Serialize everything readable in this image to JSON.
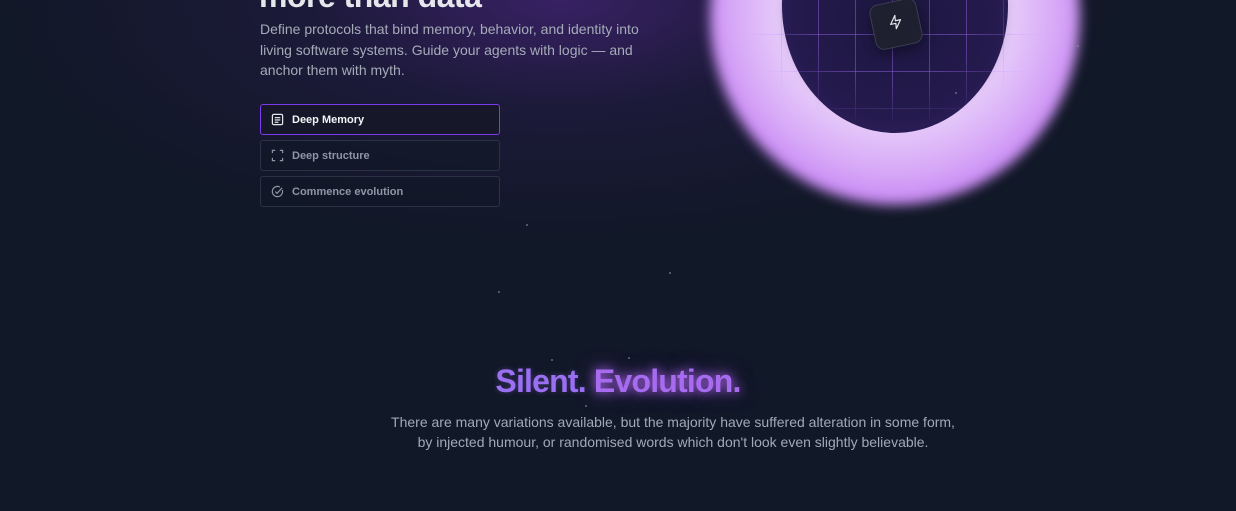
{
  "hero": {
    "title": "more than data",
    "description": "Define protocols that bind memory, behavior, and identity into living software systems. Guide your agents with logic — and anchor them with myth."
  },
  "features": [
    {
      "label": "Deep Memory",
      "icon": "document-icon",
      "active": true
    },
    {
      "label": "Deep structure",
      "icon": "focus-frame-icon",
      "active": false
    },
    {
      "label": "Commence evolution",
      "icon": "circle-check-icon",
      "active": false
    }
  ],
  "visual": {
    "badge_icon": "lightning-bolt-icon",
    "ring_color": "#c084fc",
    "grid_color": "#a76eff"
  },
  "section": {
    "title_part1": "Silent.",
    "title_part2": "Evolution.",
    "description_line1": "There are many variations available, but the majority have suffered alteration in some form,",
    "description_line2": "by injected humour, or randomised words which don't look even slightly believable."
  },
  "colors": {
    "background": "#111827",
    "accent": "#7c3aed",
    "title_purple": "#9a6ff2"
  }
}
